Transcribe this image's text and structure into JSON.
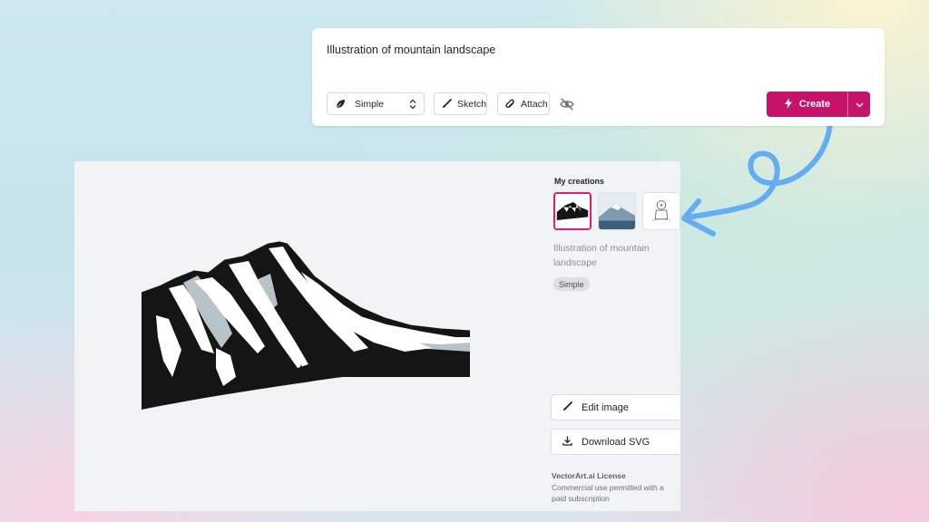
{
  "prompt": {
    "text": "Illustration of mountain landscape"
  },
  "toolbar": {
    "style_select": {
      "selected": "Simple",
      "icon": "leaf-icon"
    },
    "sketch_label": "Sketch",
    "attach_label": "Attach",
    "privacy_icon": "eye-off-icon",
    "create_label": "Create"
  },
  "sidebar": {
    "title": "My creations",
    "thumbnails": [
      "mountain-ink",
      "mountain-blue",
      "astronaut-sketch"
    ],
    "description": "Illustration of mountain landscape",
    "style_tag": "Simple",
    "edit_label": "Edit image",
    "download_label": "Download SVG",
    "license_title": "VectorArt.ai License",
    "license_text": "Commercial use permitted with a paid subscription"
  },
  "colors": {
    "accent": "#c8126a",
    "selected_border": "#e0197d",
    "arrow": "#64adf2"
  }
}
